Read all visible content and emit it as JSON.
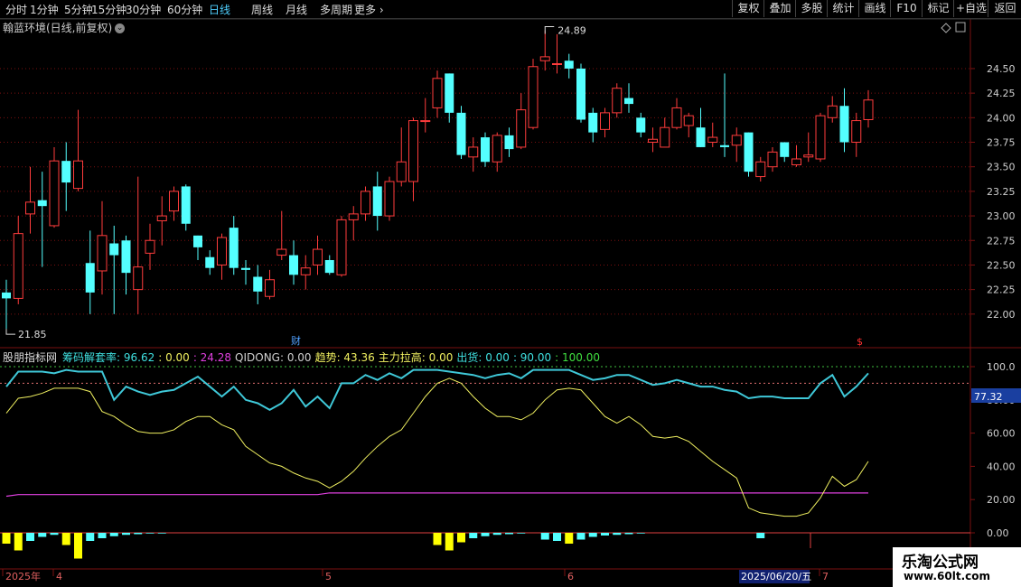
{
  "toolbar": {
    "periods": [
      "分时",
      "1分钟",
      "5分钟",
      "15分钟",
      "30分钟",
      "60分钟",
      "日线",
      "周线",
      "月线",
      "多周期",
      "更多"
    ],
    "active_period": "日线",
    "more_chevron": "›",
    "right_buttons": [
      "复权",
      "叠加",
      "多股",
      "统计",
      "画线",
      "F10",
      "标记",
      "+自选",
      "返回"
    ]
  },
  "stock": {
    "title": "翰蓝环境(日线,前复权)",
    "dropdown_icon": "chevron-down-icon"
  },
  "price_axis": {
    "ticks": [
      "24.50",
      "24.25",
      "24.00",
      "23.75",
      "23.50",
      "23.25",
      "23.00",
      "22.75",
      "22.50",
      "22.25",
      "22.00"
    ],
    "high_label": "24.89",
    "low_label": "21.85",
    "cai_marker": "财",
    "dollar_marker": "$"
  },
  "indicator": {
    "name": "股朋指标网",
    "items": [
      {
        "label": "筹码解套率: 96.62",
        "color": "#3fe0e0"
      },
      {
        "label": ": 0.00",
        "color": "#f0f060"
      },
      {
        "label": ": 24.28",
        "color": "#e040e0"
      },
      {
        "label": "QIDONG: 0.00",
        "color": "#d0d0d0"
      },
      {
        "label": "趋势: 43.36",
        "color": "#f0f060"
      },
      {
        "label": "主力拉高: 0.00",
        "color": "#f0f060"
      },
      {
        "label": "出货: 0.00",
        "color": "#3fe0e0"
      },
      {
        "label": ": 90.00",
        "color": "#3fe0e0"
      },
      {
        "label": ": 100.00",
        "color": "#40e040"
      }
    ],
    "axis_ticks": [
      "100.0",
      "80.00",
      "60.00",
      "40.00",
      "20.00",
      "0.00"
    ],
    "current_value": "77.32"
  },
  "date_axis": {
    "labels": [
      "2025年",
      "4",
      "5",
      "6",
      "7"
    ],
    "cursor_date": "2025/06/20/五"
  },
  "watermark": {
    "title": "乐淘公式网",
    "url": "www.60lt.com"
  },
  "colors": {
    "up": "#ff3c3c",
    "down": "#54ffff",
    "grid": "#7a1010",
    "axis_text": "#d0d0d0"
  },
  "candles": [
    {
      "o": 22.22,
      "c": 22.16,
      "h": 22.35,
      "l": 21.85
    },
    {
      "o": 22.16,
      "c": 22.82,
      "h": 23.0,
      "l": 22.1
    },
    {
      "o": 23.02,
      "c": 23.14,
      "h": 23.5,
      "l": 22.82
    },
    {
      "o": 23.16,
      "c": 23.1,
      "h": 23.45,
      "l": 22.48
    },
    {
      "o": 22.9,
      "c": 23.56,
      "h": 23.7,
      "l": 22.88
    },
    {
      "o": 23.56,
      "c": 23.34,
      "h": 23.75,
      "l": 23.05
    },
    {
      "o": 23.28,
      "c": 23.56,
      "h": 24.08,
      "l": 23.25
    },
    {
      "o": 22.52,
      "c": 22.22,
      "h": 22.85,
      "l": 22.0
    },
    {
      "o": 22.44,
      "c": 22.8,
      "h": 23.15,
      "l": 22.2
    },
    {
      "o": 22.72,
      "c": 22.6,
      "h": 22.9,
      "l": 22.0
    },
    {
      "o": 22.75,
      "c": 22.42,
      "h": 22.8,
      "l": 22.2
    },
    {
      "o": 22.25,
      "c": 22.48,
      "h": 23.4,
      "l": 22.0
    },
    {
      "o": 22.62,
      "c": 22.75,
      "h": 22.92,
      "l": 22.45
    },
    {
      "o": 22.95,
      "c": 23.0,
      "h": 23.2,
      "l": 22.7
    },
    {
      "o": 23.05,
      "c": 23.25,
      "h": 23.3,
      "l": 22.95
    },
    {
      "o": 23.3,
      "c": 22.92,
      "h": 23.32,
      "l": 22.85
    },
    {
      "o": 22.8,
      "c": 22.68,
      "h": 22.8,
      "l": 22.55
    },
    {
      "o": 22.58,
      "c": 22.47,
      "h": 22.65,
      "l": 22.4
    },
    {
      "o": 22.5,
      "c": 22.78,
      "h": 22.82,
      "l": 22.35
    },
    {
      "o": 22.88,
      "c": 22.47,
      "h": 23.0,
      "l": 22.4
    },
    {
      "o": 22.47,
      "c": 22.45,
      "h": 22.55,
      "l": 22.3
    },
    {
      "o": 22.38,
      "c": 22.23,
      "h": 22.5,
      "l": 22.1
    },
    {
      "o": 22.18,
      "c": 22.35,
      "h": 22.45,
      "l": 22.15
    },
    {
      "o": 22.6,
      "c": 22.66,
      "h": 23.05,
      "l": 22.55
    },
    {
      "o": 22.6,
      "c": 22.4,
      "h": 22.75,
      "l": 22.3
    },
    {
      "o": 22.4,
      "c": 22.47,
      "h": 22.6,
      "l": 22.25
    },
    {
      "o": 22.5,
      "c": 22.66,
      "h": 22.8,
      "l": 22.4
    },
    {
      "o": 22.55,
      "c": 22.42,
      "h": 22.6,
      "l": 22.4
    },
    {
      "o": 22.4,
      "c": 22.96,
      "h": 23.0,
      "l": 22.38
    },
    {
      "o": 22.96,
      "c": 23.02,
      "h": 23.1,
      "l": 22.75
    },
    {
      "o": 23.02,
      "c": 23.25,
      "h": 23.3,
      "l": 22.95
    },
    {
      "o": 23.3,
      "c": 23.0,
      "h": 23.45,
      "l": 22.85
    },
    {
      "o": 23.0,
      "c": 23.35,
      "h": 23.4,
      "l": 22.95
    },
    {
      "o": 23.35,
      "c": 23.55,
      "h": 23.9,
      "l": 23.3
    },
    {
      "o": 23.35,
      "c": 23.97,
      "h": 24.0,
      "l": 23.15
    },
    {
      "o": 23.97,
      "c": 23.97,
      "h": 24.2,
      "l": 23.85
    },
    {
      "o": 24.1,
      "c": 24.4,
      "h": 24.48,
      "l": 24.0
    },
    {
      "o": 24.45,
      "c": 24.05,
      "h": 24.45,
      "l": 23.95
    },
    {
      "o": 24.05,
      "c": 23.62,
      "h": 24.12,
      "l": 23.58
    },
    {
      "o": 23.6,
      "c": 23.7,
      "h": 23.8,
      "l": 23.45
    },
    {
      "o": 23.8,
      "c": 23.55,
      "h": 23.85,
      "l": 23.5
    },
    {
      "o": 23.55,
      "c": 23.82,
      "h": 23.85,
      "l": 23.45
    },
    {
      "o": 23.82,
      "c": 23.68,
      "h": 23.9,
      "l": 23.6
    },
    {
      "o": 23.7,
      "c": 24.08,
      "h": 24.25,
      "l": 23.68
    },
    {
      "o": 23.9,
      "c": 24.52,
      "h": 24.6,
      "l": 23.88
    },
    {
      "o": 24.58,
      "c": 24.62,
      "h": 24.89,
      "l": 24.48
    },
    {
      "o": 24.55,
      "c": 24.55,
      "h": 24.85,
      "l": 24.45
    },
    {
      "o": 24.58,
      "c": 24.5,
      "h": 24.65,
      "l": 24.4
    },
    {
      "o": 24.5,
      "c": 23.98,
      "h": 24.55,
      "l": 23.95
    },
    {
      "o": 24.05,
      "c": 23.85,
      "h": 24.1,
      "l": 23.75
    },
    {
      "o": 23.88,
      "c": 24.05,
      "h": 24.1,
      "l": 23.8
    },
    {
      "o": 24.05,
      "c": 24.3,
      "h": 24.35,
      "l": 24.0
    },
    {
      "o": 24.2,
      "c": 24.14,
      "h": 24.35,
      "l": 24.05
    },
    {
      "o": 24.0,
      "c": 23.85,
      "h": 24.05,
      "l": 23.8
    },
    {
      "o": 23.75,
      "c": 23.78,
      "h": 23.9,
      "l": 23.65
    },
    {
      "o": 23.7,
      "c": 23.9,
      "h": 24.0,
      "l": 23.7
    },
    {
      "o": 23.9,
      "c": 24.1,
      "h": 24.2,
      "l": 23.88
    },
    {
      "o": 23.92,
      "c": 24.02,
      "h": 24.05,
      "l": 23.8
    },
    {
      "o": 23.9,
      "c": 23.7,
      "h": 24.1,
      "l": 23.7
    },
    {
      "o": 23.75,
      "c": 23.8,
      "h": 23.95,
      "l": 23.7
    },
    {
      "o": 23.72,
      "c": 23.7,
      "h": 24.45,
      "l": 23.6
    },
    {
      "o": 23.72,
      "c": 23.82,
      "h": 23.9,
      "l": 23.55
    },
    {
      "o": 23.85,
      "c": 23.45,
      "h": 23.85,
      "l": 23.4
    },
    {
      "o": 23.4,
      "c": 23.55,
      "h": 23.6,
      "l": 23.35
    },
    {
      "o": 23.5,
      "c": 23.65,
      "h": 23.7,
      "l": 23.45
    },
    {
      "o": 23.75,
      "c": 23.6,
      "h": 23.75,
      "l": 23.55
    },
    {
      "o": 23.52,
      "c": 23.58,
      "h": 23.72,
      "l": 23.5
    },
    {
      "o": 23.6,
      "c": 23.62,
      "h": 23.85,
      "l": 23.55
    },
    {
      "o": 23.58,
      "c": 24.02,
      "h": 24.05,
      "l": 23.55
    },
    {
      "o": 24.0,
      "c": 24.12,
      "h": 24.22,
      "l": 23.95
    },
    {
      "o": 24.12,
      "c": 23.75,
      "h": 24.3,
      "l": 23.65
    },
    {
      "o": 23.75,
      "c": 23.97,
      "h": 24.05,
      "l": 23.6
    },
    {
      "o": 23.98,
      "c": 24.18,
      "h": 24.28,
      "l": 23.9
    }
  ],
  "ind_series": {
    "cyan": [
      88,
      97,
      97,
      97,
      96,
      98,
      97,
      97,
      97,
      80,
      88,
      85,
      83,
      85,
      86,
      90,
      94,
      88,
      82,
      88,
      80,
      78,
      74,
      78,
      86,
      76,
      82,
      75,
      90,
      90,
      95,
      92,
      96,
      93,
      98,
      98,
      98,
      97,
      96,
      95,
      93,
      95,
      96,
      93,
      98,
      98,
      98,
      98,
      95,
      92,
      93,
      95,
      95,
      92,
      89,
      90,
      92,
      90,
      88,
      88,
      86,
      85,
      81,
      82,
      82,
      81,
      81,
      81,
      90,
      95,
      82,
      88,
      96
    ],
    "yellow": [
      72,
      81,
      82,
      84,
      87,
      87,
      87,
      85,
      73,
      70,
      65,
      61,
      60,
      60,
      62,
      67,
      70,
      70,
      65,
      62,
      52,
      47,
      42,
      40,
      36,
      33,
      31,
      27,
      31,
      37,
      45,
      52,
      58,
      62,
      72,
      82,
      90,
      93,
      90,
      82,
      75,
      70,
      70,
      68,
      72,
      80,
      86,
      87,
      86,
      78,
      70,
      66,
      70,
      65,
      58,
      57,
      58,
      55,
      49,
      43,
      38,
      33,
      15,
      12,
      11,
      10,
      10,
      12,
      21,
      34,
      28,
      32,
      43
    ],
    "magenta": [
      22,
      23,
      23,
      23,
      23,
      23,
      23,
      23,
      23,
      23,
      23,
      23,
      23,
      23,
      23,
      23,
      23,
      23,
      23,
      23,
      23,
      23,
      23,
      23,
      23,
      23,
      23,
      24,
      24,
      24,
      24,
      24,
      24,
      24,
      24,
      24,
      24,
      24,
      24,
      24,
      24,
      24,
      24,
      24,
      24,
      24,
      24,
      24,
      24,
      24,
      24,
      24,
      24,
      24,
      24,
      24,
      24,
      24,
      24,
      24,
      24,
      24,
      24,
      24,
      24,
      24,
      24,
      24,
      24,
      24,
      24,
      24,
      24
    ],
    "bars": [
      -16,
      -26,
      -12,
      -6,
      -3,
      -18,
      -38,
      -12,
      -8,
      -5,
      -3,
      -2,
      -1,
      -1,
      0,
      0,
      0,
      0,
      0,
      0,
      0,
      0,
      0,
      0,
      0,
      0,
      0,
      0,
      0,
      0,
      0,
      0,
      0,
      0,
      0,
      0,
      -18,
      -26,
      -14,
      -8,
      -5,
      -3,
      -2,
      -1,
      0,
      -10,
      -12,
      -16,
      -10,
      -6,
      -4,
      -3,
      -2,
      -1,
      0,
      0,
      0,
      0,
      0,
      0,
      0,
      0,
      0,
      -8,
      0,
      0,
      0,
      0,
      0,
      0,
      0,
      0,
      0
    ]
  }
}
